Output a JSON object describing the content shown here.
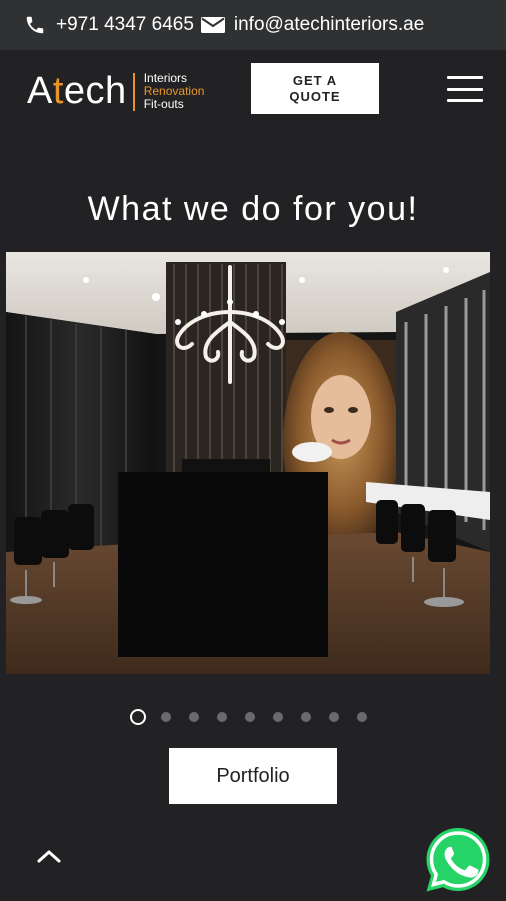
{
  "topbar": {
    "phone_icon": "phone-icon",
    "phone": "+971 4347 6465",
    "email_icon": "envelope-icon",
    "email": "info@atechinteriors.ae"
  },
  "header": {
    "logo_first_letter": "A",
    "logo_accent_letter": "t",
    "logo_rest": "ech",
    "tagline_1": "Interiors",
    "tagline_2": "Renovation",
    "tagline_3": "Fit-outs",
    "quote_label_1": "GET A",
    "quote_label_2": "QUOTE",
    "menu_icon": "hamburger-icon"
  },
  "main": {
    "heading": "What we do for you!",
    "slider": {
      "image_subject": "salon interior with chandelier and portrait wall",
      "slide_count": 9,
      "active_index": 0
    },
    "portfolio_label": "Portfolio"
  },
  "footer": {
    "scroll_up_icon": "chevron-up-icon",
    "whatsapp_icon": "whatsapp-icon"
  },
  "colors": {
    "background": "#222224",
    "topbar": "#303133",
    "accent": "#e8962a",
    "whatsapp": "#25d366"
  }
}
